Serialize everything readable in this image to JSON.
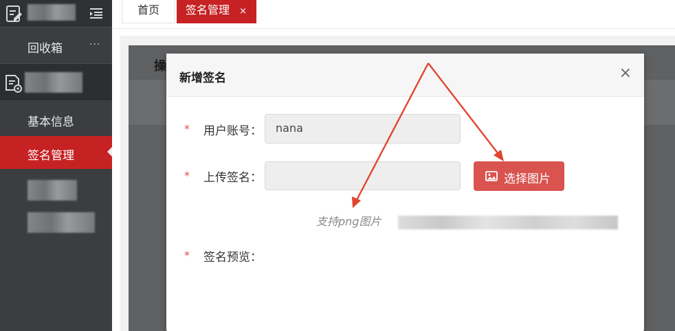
{
  "sidebar": {
    "recycle_label": "回收箱",
    "recycle_more": "...",
    "basic_info_label": "基本信息",
    "sign_manage_label": "签名管理",
    "active_color": "#c62224"
  },
  "tabs": {
    "home_label": "首页",
    "sign_label": "签名管理",
    "close_glyph": "×"
  },
  "background": {
    "peek_text": "操"
  },
  "modal": {
    "title": "新增签名",
    "close_glyph": "×",
    "required_mark": "*",
    "account_label": "用户账号：",
    "account_value": "nana",
    "upload_label": "上传签名：",
    "upload_value": "",
    "choose_button_label": "选择图片",
    "hint_text": "支持png图片",
    "preview_label": "签名预览：",
    "accent_color": "#d9534f"
  },
  "annotation": {
    "arrow_color": "#e0452f"
  }
}
